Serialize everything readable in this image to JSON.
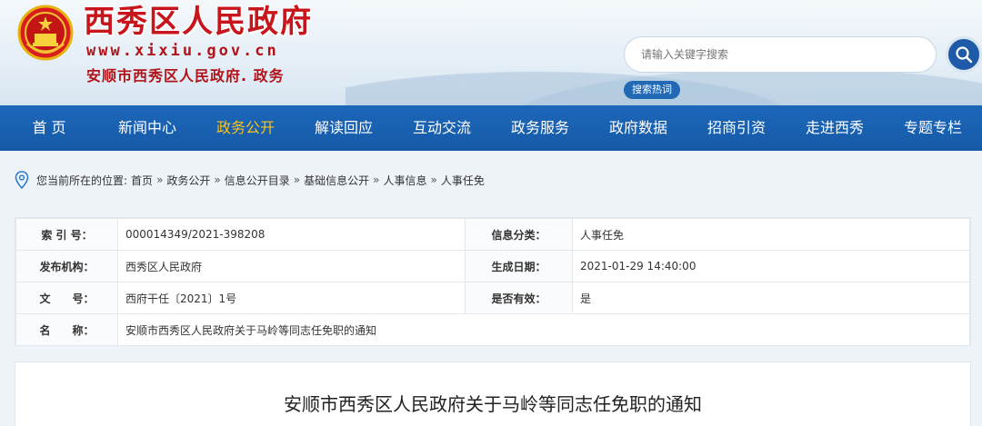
{
  "header": {
    "site_title": "西秀区人民政府",
    "site_url": "www.xixiu.gov.cn",
    "site_subtitle": "安顺市西秀区人民政府. 政务",
    "search_placeholder": "请输入关键字搜索",
    "hot_tag": "搜索热词"
  },
  "nav": {
    "items": [
      {
        "label": "首  页"
      },
      {
        "label": "新闻中心"
      },
      {
        "label": "政务公开"
      },
      {
        "label": "解读回应"
      },
      {
        "label": "互动交流"
      },
      {
        "label": "政务服务"
      },
      {
        "label": "政府数据"
      },
      {
        "label": "招商引资"
      },
      {
        "label": "走进西秀"
      },
      {
        "label": "专题专栏"
      }
    ],
    "active_index": 2
  },
  "breadcrumb": {
    "prefix": "您当前所在的位置:",
    "items": [
      "首页",
      "政务公开",
      "信息公开目录",
      "基础信息公开",
      "人事信息",
      "人事任免"
    ],
    "separator": "»"
  },
  "info": {
    "rows": [
      {
        "l1": "索 引 号：",
        "v1": "000014349/2021-398208",
        "l2": "信息分类：",
        "v2": "人事任免"
      },
      {
        "l1": "发布机构：",
        "v1": "西秀区人民政府",
        "l2": "生成日期：",
        "v2": "2021-01-29 14:40:00"
      },
      {
        "l1": "文　　号：",
        "v1": "西府干任〔2021〕1号",
        "l2": "是否有效：",
        "v2": "是"
      },
      {
        "l1": "名　　称：",
        "v1": "安顺市西秀区人民政府关于马岭等同志任免职的通知"
      }
    ]
  },
  "content": {
    "title": "安顺市西秀区人民政府关于马岭等同志任免职的通知"
  },
  "colors": {
    "nav_bg": "#155aa8",
    "nav_active": "#f9c31a",
    "title_red": "#c8151b",
    "search_btn": "#1f5aa8"
  },
  "icons": {
    "emblem": "national-emblem-icon",
    "search": "search-icon",
    "location": "location-pin-icon"
  }
}
